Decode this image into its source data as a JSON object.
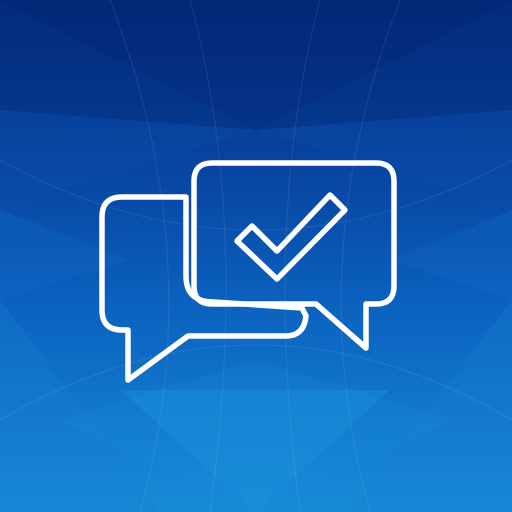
{
  "icon": {
    "name": "chat-approval-app-icon",
    "glyph": "chat-bubbles-checkmark-icon",
    "colors": {
      "background_top": "#05328a",
      "background_mid": "#0b57b5",
      "background_bottom": "#1a8ad8",
      "glyph_stroke": "#ffffff"
    }
  }
}
